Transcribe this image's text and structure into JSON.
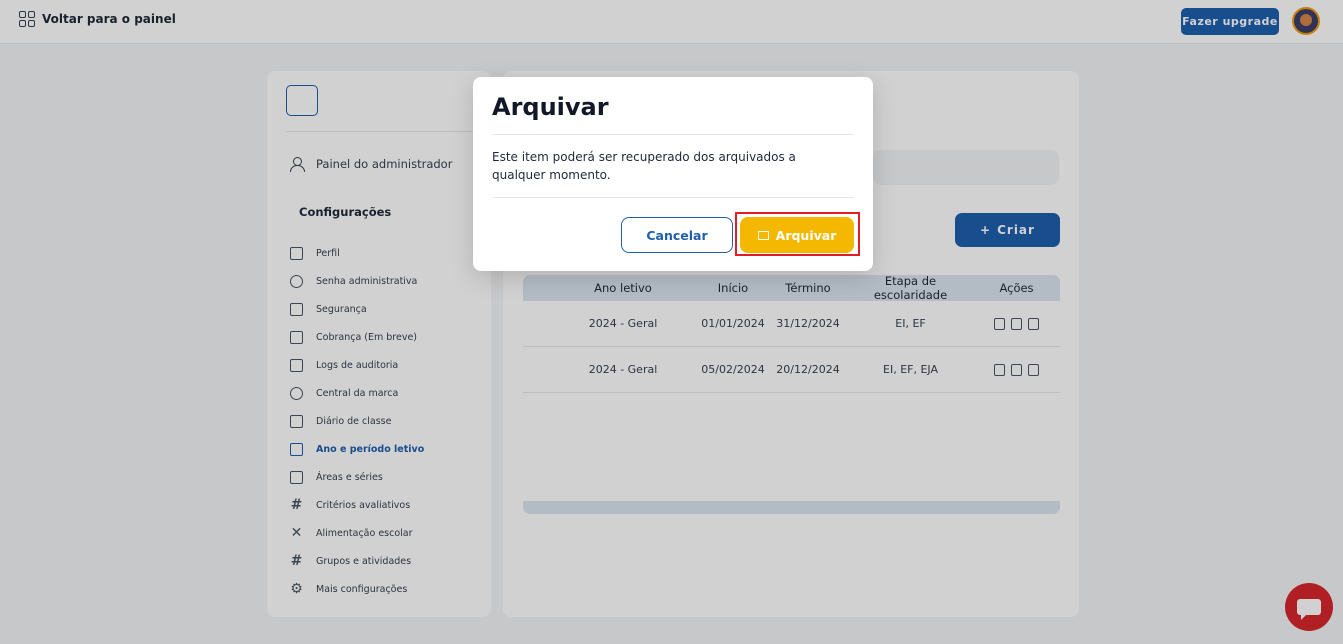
{
  "topbar": {
    "back_label": "Voltar para o painel",
    "upgrade_label": "Fazer upgrade"
  },
  "sidebar": {
    "admin_label": "Painel do administrador",
    "config_title": "Configurações",
    "items": [
      {
        "label": "Perfil",
        "icon": "id-card-icon"
      },
      {
        "label": "Senha administrativa",
        "icon": "key-icon"
      },
      {
        "label": "Segurança",
        "icon": "shield-icon"
      },
      {
        "label": "Cobrança (Em breve)",
        "icon": "credit-card-icon"
      },
      {
        "label": "Logs de auditoria",
        "icon": "audit-file-icon"
      },
      {
        "label": "Central da marca",
        "icon": "palette-icon"
      },
      {
        "label": "Diário de classe",
        "icon": "document-icon"
      },
      {
        "label": "Ano e período letivo",
        "icon": "calendar-grid-icon"
      },
      {
        "label": "Áreas e séries",
        "icon": "book-icon"
      },
      {
        "label": "Critérios avaliativos",
        "icon": "hash-icon"
      },
      {
        "label": "Alimentação escolar",
        "icon": "utensils-icon"
      },
      {
        "label": "Grupos e atividades",
        "icon": "hash-icon"
      },
      {
        "label": "Mais configurações",
        "icon": "gear-icon"
      }
    ]
  },
  "main": {
    "create_label": "Criar",
    "table": {
      "headers": [
        "Ano letivo",
        "Início",
        "Término",
        "Etapa de escolaridade",
        "Ações"
      ],
      "rows": [
        [
          "2024 - Geral",
          "01/01/2024",
          "31/12/2024",
          "EI, EF"
        ],
        [
          "2024 - Geral",
          "05/02/2024",
          "20/12/2024",
          "EI, EF, EJA"
        ]
      ]
    }
  },
  "modal": {
    "title": "Arquivar",
    "message": "Este item poderá ser recuperado dos arquivados a qualquer momento.",
    "cancel_label": "Cancelar",
    "confirm_label": "Arquivar"
  },
  "colors": {
    "primary": "#1e5fae",
    "confirm": "#f5b800",
    "highlight": "#e11d27",
    "chat": "#d7262b"
  }
}
